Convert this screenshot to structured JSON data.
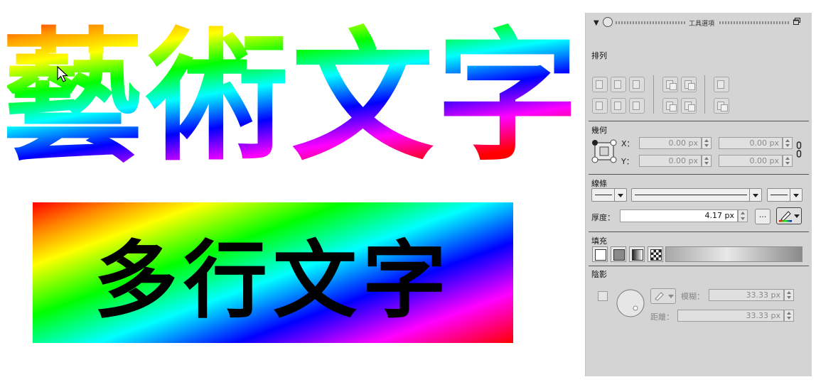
{
  "canvas": {
    "art_title": "藝術文字",
    "banner_text": "多行文字"
  },
  "panel": {
    "title": "工具選項",
    "sections": {
      "arrange": "排列",
      "geometry": "幾何",
      "stroke": "線條",
      "fill": "填充",
      "shadow": "陰影"
    },
    "geometry": {
      "x_label": "X：",
      "y_label": "Y：",
      "x_value": "0.00 px",
      "width_value": "0.00 px",
      "y_value": "0.00 px",
      "height_value": "0.00 px"
    },
    "stroke": {
      "thickness_label": "厚度：",
      "thickness_value": "4.17 px",
      "more_label": "..."
    },
    "shadow": {
      "blur_label": "模糊：",
      "blur_value": "33.33 px",
      "distance_label": "距離：",
      "distance_value": "33.33 px"
    }
  },
  "icons": {
    "cursor": "mouse-pointer-icon",
    "collapse": "triangle-down-icon",
    "float": "float-window-icon",
    "lock": "link-lock-icon"
  }
}
